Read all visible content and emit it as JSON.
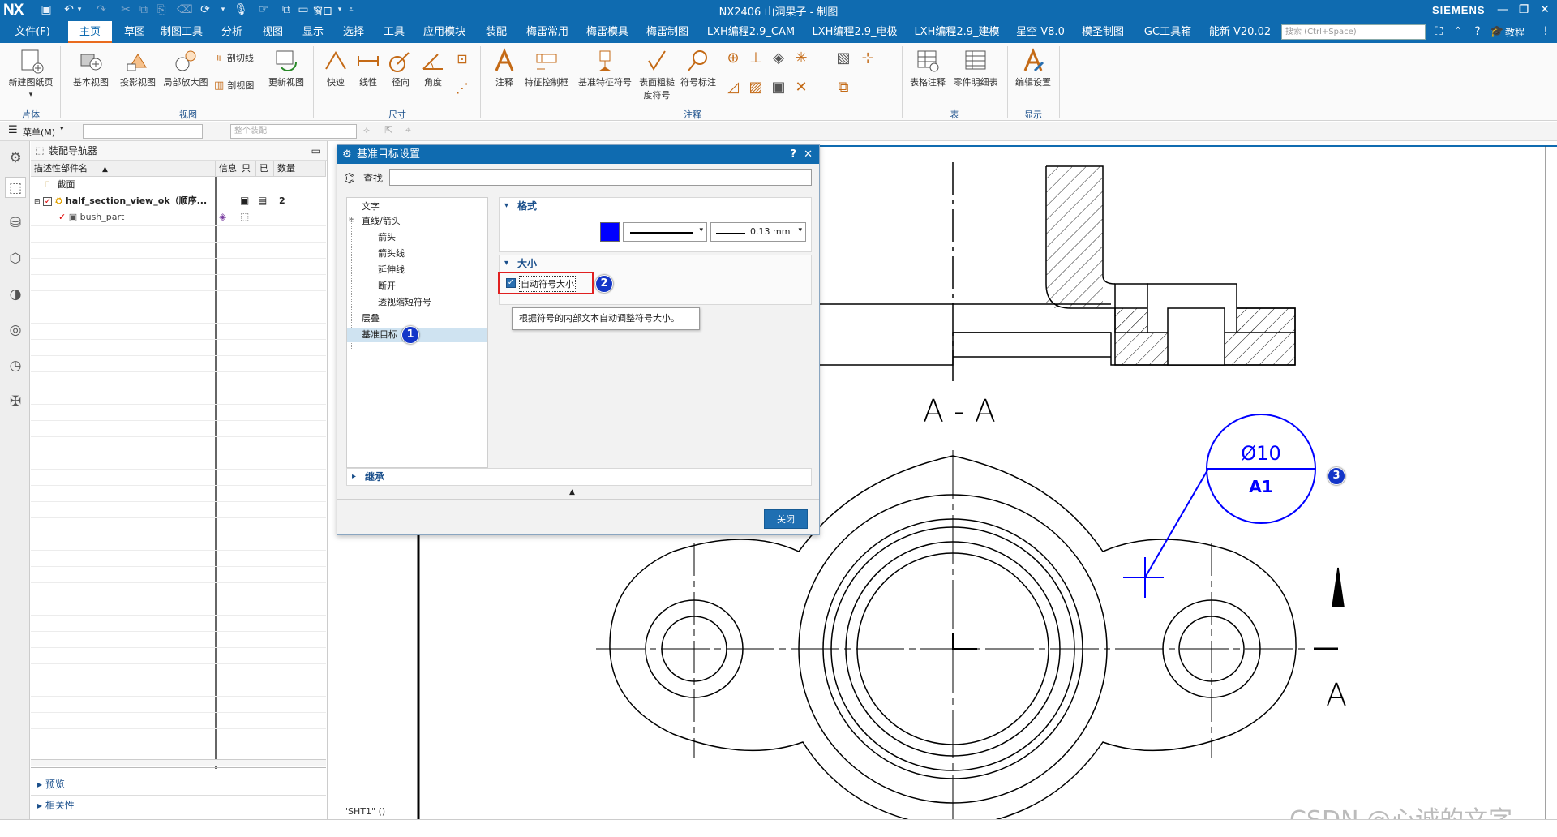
{
  "app": {
    "logo": "NX",
    "title": "NX2406 山洞果子 - 制图",
    "brand": "SIEMENS",
    "window_menu": "窗口"
  },
  "menu": {
    "tabs": [
      "文件(F)",
      "主页",
      "草图",
      "制图工具",
      "分析",
      "视图",
      "显示",
      "选择",
      "工具",
      "应用模块",
      "装配",
      "梅雷常用",
      "梅雷模具",
      "梅雷制图",
      "LXH编程2.9_CAM",
      "LXH编程2.9_电极",
      "LXH编程2.9_建模",
      "星空 V8.0",
      "模圣制图",
      "GC工具箱",
      "能新 V20.02"
    ],
    "active_index": 1,
    "search_placeholder": "搜索 (Ctrl+Space)",
    "tutorial_label": "教程"
  },
  "ribbon": {
    "buttons": {
      "new_sheet": "新建图纸页",
      "base_view": "基本视图",
      "proj_view": "投影视图",
      "detail_view": "局部放大图",
      "section_line": "剖切线",
      "section_view": "剖视图",
      "update_view": "更新视图",
      "quick": "快速",
      "linear": "线性",
      "radial": "径向",
      "angle": "角度",
      "note": "注释",
      "fcf": "特征控制框",
      "datum_symbol": "基准特征符号",
      "surface_finish_1": "表面粗糙",
      "surface_finish_2": "度符号",
      "symbol_note": "符号标注",
      "table_note": "表格注释",
      "parts_list": "零件明细表",
      "edit_settings": "编辑设置"
    },
    "groups": {
      "sheet": "片体",
      "view": "视图",
      "dimension": "尺寸",
      "annotation": "注释",
      "table": "表",
      "display": "显示"
    }
  },
  "cmdbar": {
    "menu_label": "菜单(M)",
    "filter_placeholder": "",
    "assembly_placeholder": "整个装配"
  },
  "navigator": {
    "title": "装配导航器",
    "columns": [
      "描述性部件名",
      "信息",
      "只",
      "已",
      "数量"
    ],
    "rows": [
      {
        "name": "截面"
      },
      {
        "name": "half_section_view_ok（顺序...",
        "count": "2"
      },
      {
        "name": "bush_part"
      }
    ],
    "bottom": [
      "预览",
      "相关性"
    ]
  },
  "dialog": {
    "title": "基准目标设置",
    "help": "?",
    "find_label": "查找",
    "find_value": "",
    "tree": [
      {
        "label": "文字",
        "indent": 1
      },
      {
        "label": "直线/箭头",
        "indent": 1
      },
      {
        "label": "箭头",
        "indent": 2
      },
      {
        "label": "箭头线",
        "indent": 2
      },
      {
        "label": "延伸线",
        "indent": 2
      },
      {
        "label": "断开",
        "indent": 2
      },
      {
        "label": "透视缩短符号",
        "indent": 2
      },
      {
        "label": "层叠",
        "indent": 1
      },
      {
        "label": "基准目标",
        "indent": 1,
        "selected": true
      }
    ],
    "format_header": "格式",
    "color": "#0000ff",
    "line_width": "0.13 mm",
    "size_header": "大小",
    "auto_size_label": "自动符号大小",
    "auto_size_checked": true,
    "tooltip": "根据符号的内部文本自动调整符号大小。",
    "inherit_header": "继承",
    "close_button": "关闭"
  },
  "badges": {
    "b1": "1",
    "b2": "2",
    "b3": "3"
  },
  "drawing": {
    "section_label": "A - A",
    "arrow_label": "A",
    "datum_diameter": "Ø10",
    "datum_id": "A1",
    "sheet_label": "\"SHT1\" ()",
    "line_color": "#0000ff"
  },
  "watermark": "CSDN @心诚的文字"
}
